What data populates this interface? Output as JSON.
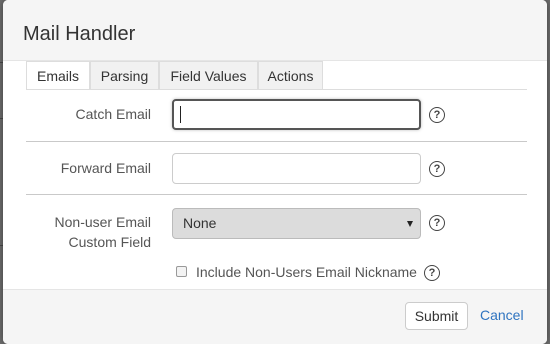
{
  "modal": {
    "title": "Mail Handler"
  },
  "tabs": [
    {
      "label": "Emails",
      "active": true
    },
    {
      "label": "Parsing",
      "active": false
    },
    {
      "label": "Field Values",
      "active": false
    },
    {
      "label": "Actions",
      "active": false
    }
  ],
  "form": {
    "catch_email": {
      "label": "Catch Email",
      "value": ""
    },
    "forward_email": {
      "label": "Forward Email",
      "value": ""
    },
    "non_user_email_field": {
      "label_line1": "Non-user Email",
      "label_line2": "Custom Field",
      "selected": "None"
    },
    "include_nickname": {
      "label": "Include Non-Users Email Nickname",
      "checked": false
    },
    "help_glyph": "?"
  },
  "footer": {
    "submit_label": "Submit",
    "cancel_label": "Cancel"
  },
  "colors": {
    "link": "#2f74c0",
    "header_bg": "#f5f5f5",
    "overlay": "#6f6f6f"
  }
}
